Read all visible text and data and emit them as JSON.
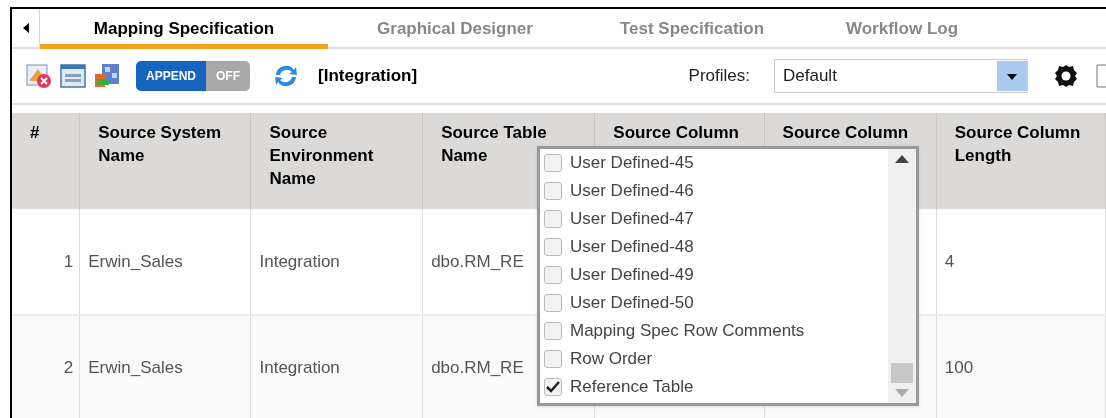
{
  "tabs": [
    {
      "label": "Mapping Specification",
      "selected": true
    },
    {
      "label": "Graphical Designer",
      "selected": false
    },
    {
      "label": "Test Specification",
      "selected": false
    },
    {
      "label": "Workflow Log",
      "selected": false
    }
  ],
  "toolbar": {
    "toggle": {
      "label": "APPEND",
      "off_label": "OFF",
      "on": true
    },
    "context": "[Integration]",
    "profiles_label": "Profiles:",
    "profile": "Default"
  },
  "table": {
    "columns": [
      "#",
      "Source System Name",
      "Source Environment Name",
      "Source Table Name",
      "Source Column",
      "Source Column",
      "Source Column Length"
    ],
    "rows": [
      [
        "1",
        "Erwin_Sales",
        "Integration",
        "dbo.RM_RE",
        "",
        "",
        "4"
      ],
      [
        "2",
        "Erwin_Sales",
        "Integration",
        "dbo.RM_RE",
        "",
        "",
        "100"
      ]
    ]
  },
  "column_chooser": {
    "items": [
      {
        "label": "User Defined-45",
        "checked": false
      },
      {
        "label": "User Defined-46",
        "checked": false
      },
      {
        "label": "User Defined-47",
        "checked": false
      },
      {
        "label": "User Defined-48",
        "checked": false
      },
      {
        "label": "User Defined-49",
        "checked": false
      },
      {
        "label": "User Defined-50",
        "checked": false
      },
      {
        "label": "Mapping Spec Row Comments",
        "checked": false
      },
      {
        "label": "Row Order",
        "checked": false
      },
      {
        "label": "Reference Table",
        "checked": true
      }
    ]
  }
}
